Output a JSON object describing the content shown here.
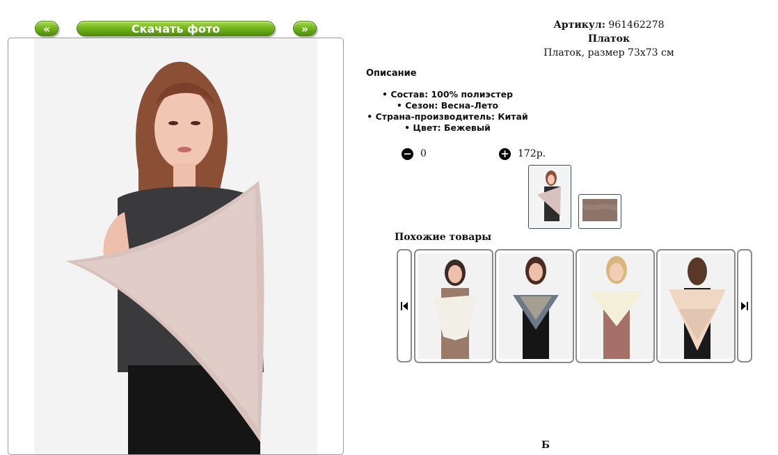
{
  "nav": {
    "prev_label": "«",
    "download_label": "Скачать фото",
    "next_label": "»"
  },
  "product": {
    "article_label": "Артикул:",
    "article_value": "961462278",
    "name": "Платок",
    "subtitle": "Платок, размер 73х73 см"
  },
  "description": {
    "title": "Описание",
    "specs": [
      "Состав: 100% полиэстер",
      "Сезон: Весна-Лето",
      "Страна-производитель: Китай",
      "Цвет: Бежевый"
    ]
  },
  "quantity": {
    "minus_icon": "minus-circle-icon",
    "value": "0",
    "plus_icon": "plus-circle-icon",
    "price": "172р."
  },
  "gallery": {
    "thumbnails": [
      "woman-with-beige-scarf",
      "scarf-fabric-closeup"
    ]
  },
  "similar": {
    "title": "Похожие товары",
    "items": [
      "white-lace-scarf",
      "blue-patterned-scarf",
      "cream-scarf-front",
      "cream-lace-scarf-back"
    ],
    "prev_icon": "skip-back-icon",
    "next_icon": "skip-forward-icon"
  },
  "footer_cut_text": "Б"
}
